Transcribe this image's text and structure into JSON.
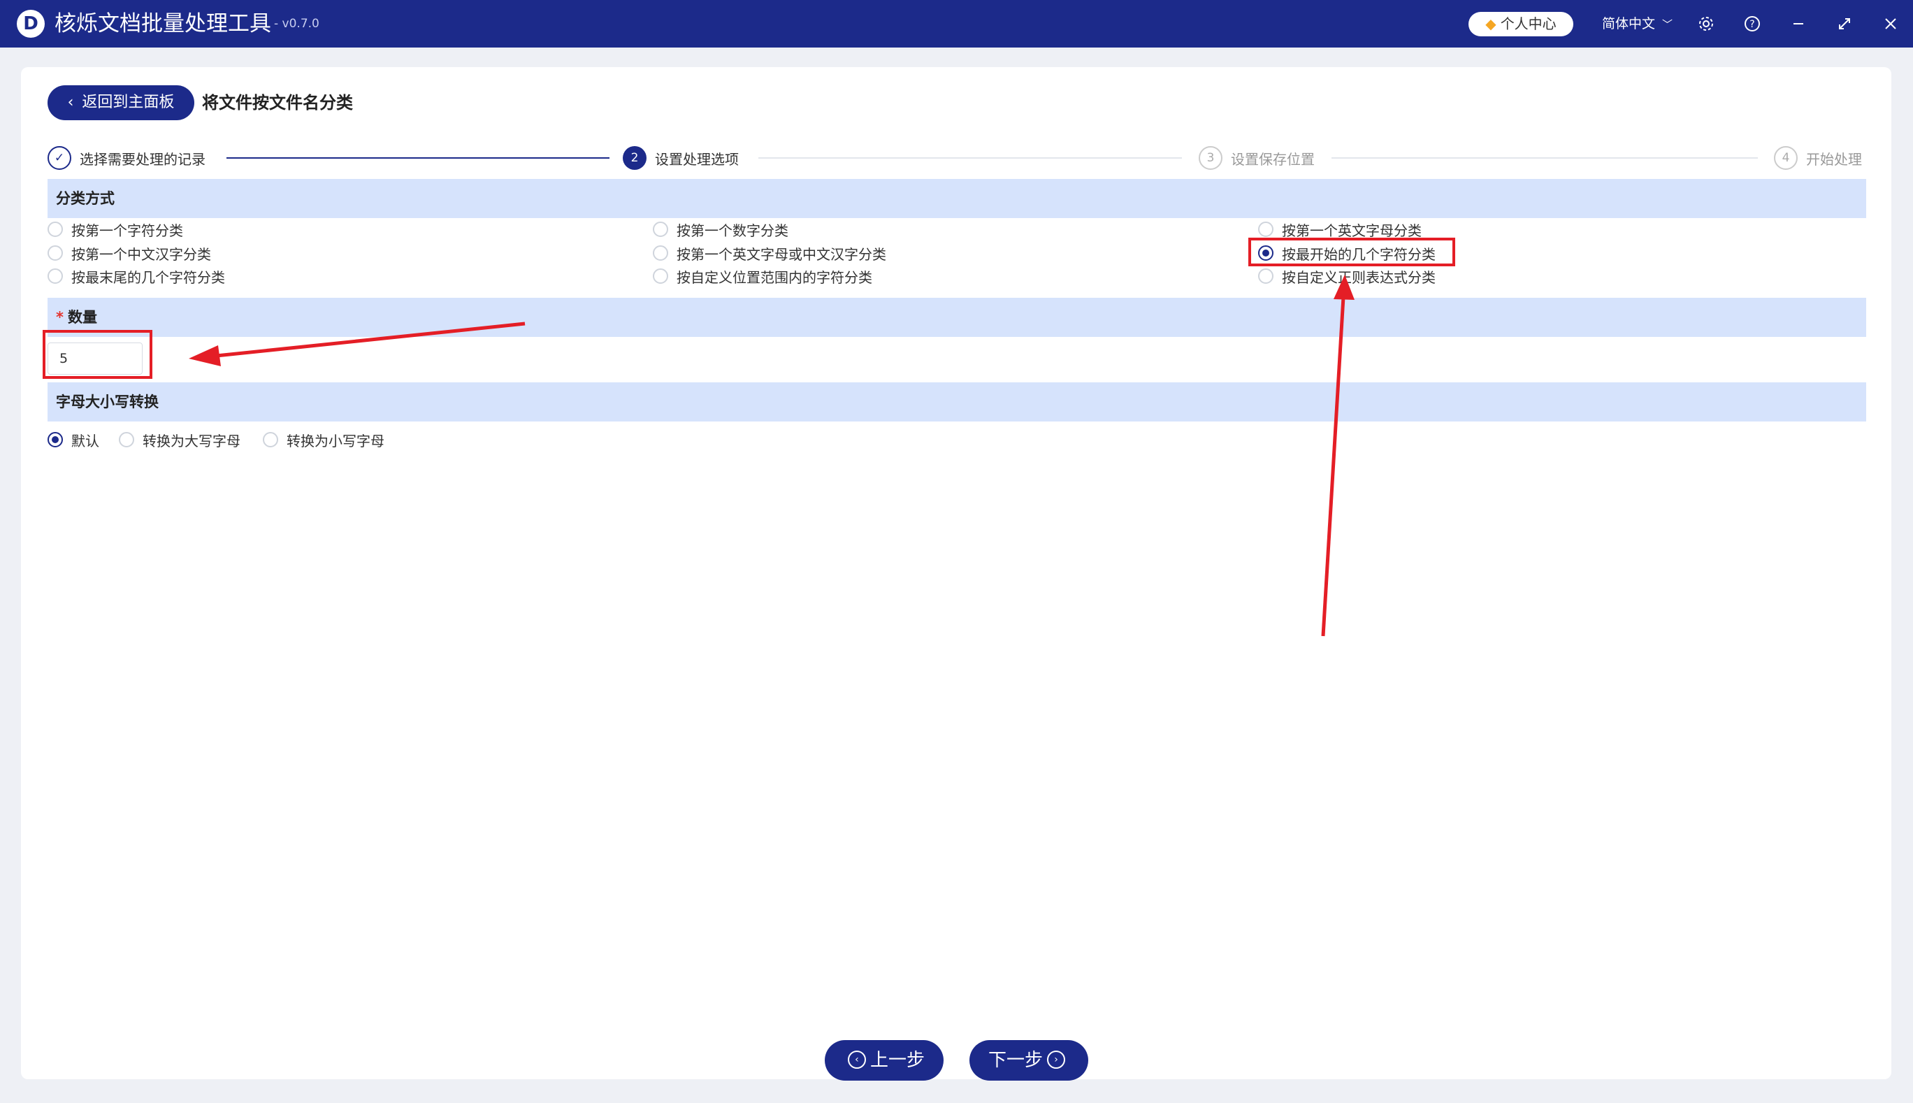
{
  "titlebar": {
    "logo_letter": "D",
    "app_name": "核烁文档批量处理工具",
    "version": "- v0.7.0",
    "user_center": "个人中心",
    "language": "简体中文",
    "icons": [
      "settings-icon",
      "help-icon",
      "minimize-icon",
      "maximize-icon",
      "close-icon"
    ]
  },
  "header": {
    "back_label": "返回到主面板",
    "page_title": "将文件按文件名分类"
  },
  "steps": [
    {
      "num": "✓",
      "label": "选择需要处理的记录",
      "state": "done"
    },
    {
      "num": "2",
      "label": "设置处理选项",
      "state": "active"
    },
    {
      "num": "3",
      "label": "设置保存位置",
      "state": "todo"
    },
    {
      "num": "4",
      "label": "开始处理",
      "state": "todo"
    }
  ],
  "classify": {
    "title": "分类方式",
    "options": [
      {
        "label": "按第一个字符分类",
        "checked": false
      },
      {
        "label": "按第一个数字分类",
        "checked": false
      },
      {
        "label": "按第一个英文字母分类",
        "checked": false
      },
      {
        "label": "按第一个中文汉字分类",
        "checked": false
      },
      {
        "label": "按第一个英文字母或中文汉字分类",
        "checked": false
      },
      {
        "label": "按最开始的几个字符分类",
        "checked": true
      },
      {
        "label": "按最末尾的几个字符分类",
        "checked": false
      },
      {
        "label": "按自定义位置范围内的字符分类",
        "checked": false
      },
      {
        "label": "按自定义正则表达式分类",
        "checked": false
      }
    ]
  },
  "quantity": {
    "required_mark": "*",
    "title": "数量",
    "value": "5"
  },
  "case_convert": {
    "title": "字母大小写转换",
    "options": [
      {
        "label": "默认",
        "checked": true
      },
      {
        "label": "转换为大写字母",
        "checked": false
      },
      {
        "label": "转换为小写字母",
        "checked": false
      }
    ]
  },
  "footer": {
    "prev_label": "上一步",
    "next_label": "下一步"
  },
  "colors": {
    "primary": "#1c2a8a",
    "section_bg": "#d6e3fc",
    "annotation_red": "#e41e26"
  }
}
